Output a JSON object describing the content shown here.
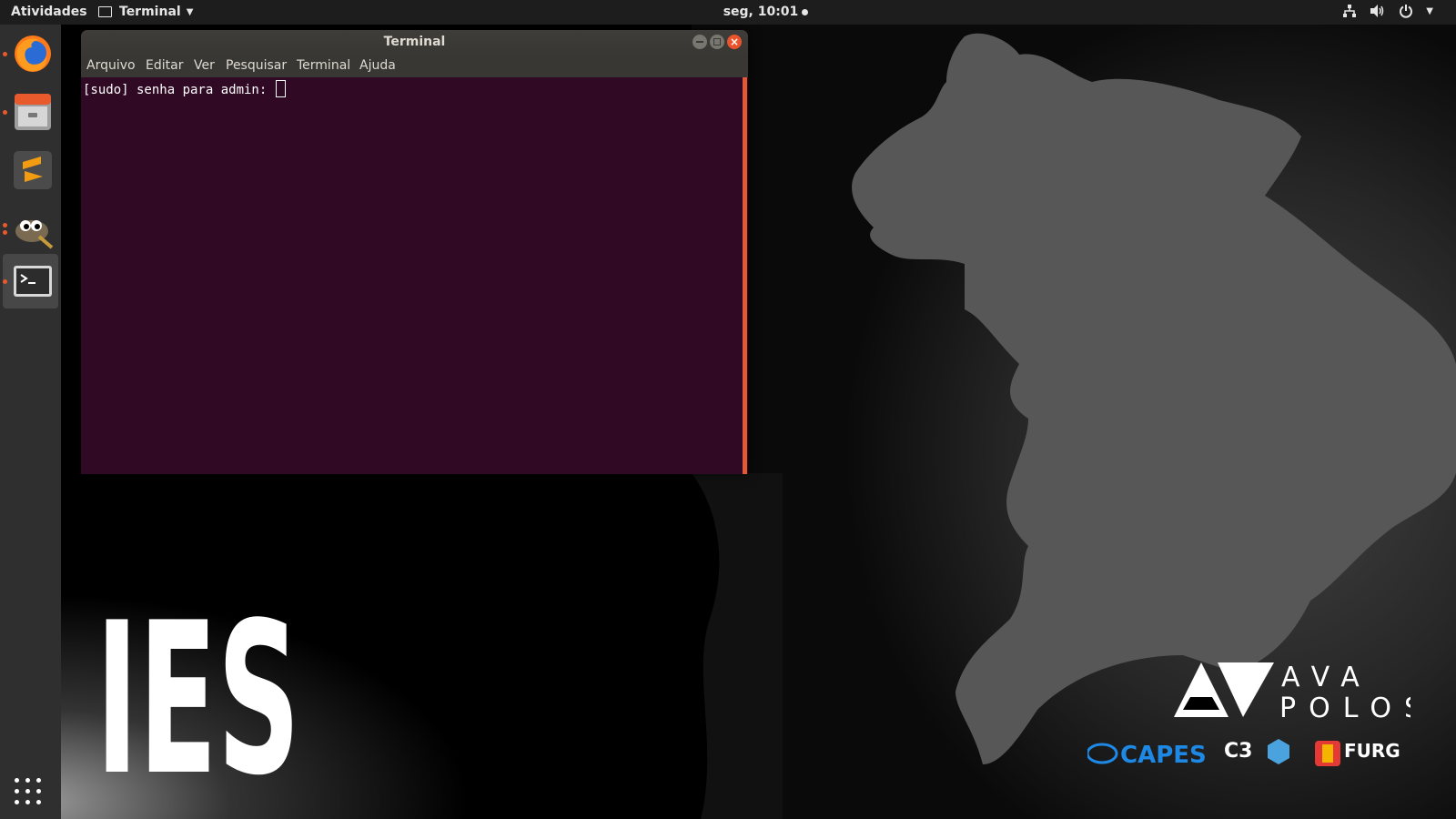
{
  "topbar": {
    "activities": "Atividades",
    "app_menu": "Terminal",
    "clock": "seg, 10:01",
    "tray_icons": [
      "network-icon",
      "volume-icon",
      "power-icon",
      "chevron-down-icon"
    ]
  },
  "dock": {
    "items": [
      {
        "name": "Firefox",
        "icon": "firefox-icon",
        "running": true
      },
      {
        "name": "Arquivos",
        "icon": "files-icon",
        "running": true
      },
      {
        "name": "Sublime Text",
        "icon": "sublime-icon",
        "running": false
      },
      {
        "name": "GIMP",
        "icon": "gimp-icon",
        "running": true
      },
      {
        "name": "Terminal",
        "icon": "terminal-icon",
        "running": true,
        "active": true
      }
    ],
    "show_apps_icon": "apps-grid-icon"
  },
  "terminal": {
    "title": "Terminal",
    "menu": [
      "Arquivo",
      "Editar",
      "Ver",
      "Pesquisar",
      "Terminal",
      "Ajuda"
    ],
    "prompt": "[sudo] senha para admin: ",
    "colors": {
      "background": "#300a24",
      "scrollbar": "#e05a34",
      "close": "#e9542c"
    }
  },
  "wallpaper": {
    "big_text": "IES",
    "brand_line1": "AVA",
    "brand_line2": "POLOS",
    "partner_logos": [
      "CAPES",
      "C3",
      "FURG"
    ]
  }
}
